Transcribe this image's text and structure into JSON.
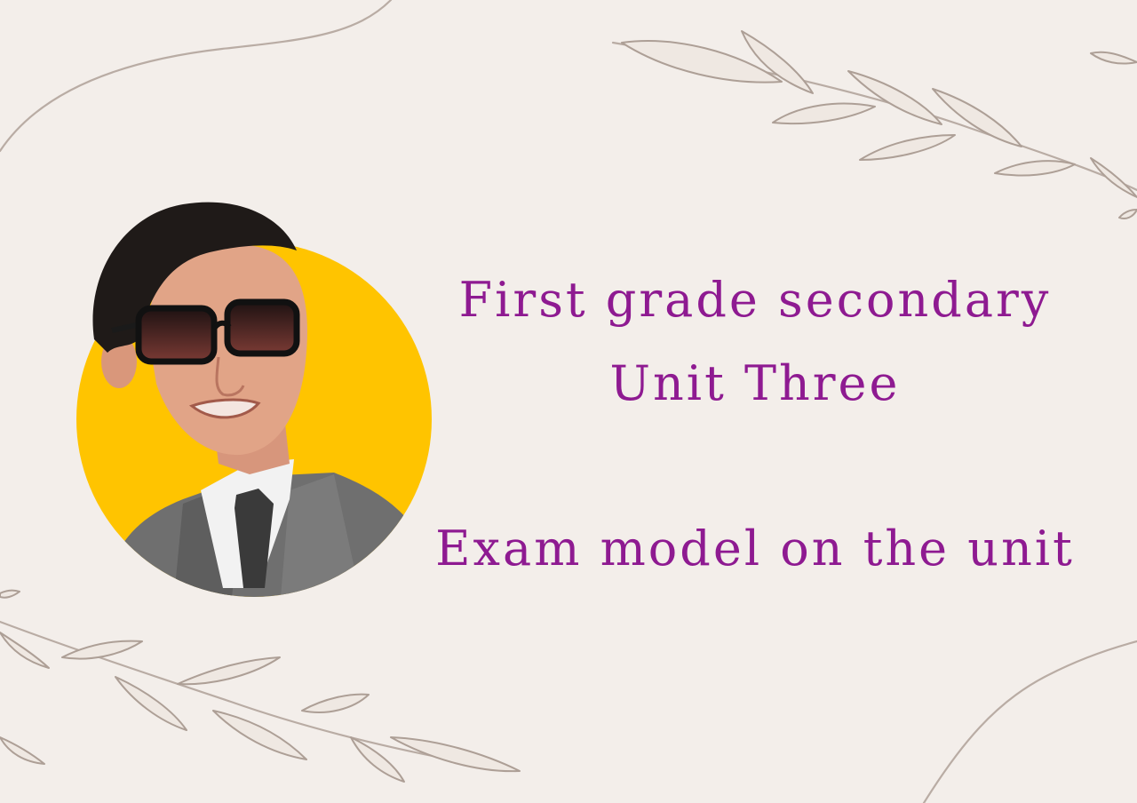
{
  "slide": {
    "title_line_1": "First grade secondary",
    "title_line_2": "Unit Three",
    "title_line_3": "Exam model on the unit"
  },
  "colors": {
    "background": "#f3eeea",
    "title_text": "#8e1a91",
    "accent_circle": "#ffc400",
    "decor_lines": "#b9aca4"
  },
  "icons": {
    "portrait": "teacher-portrait-illustration",
    "decor": "botanical-branch-lines"
  }
}
